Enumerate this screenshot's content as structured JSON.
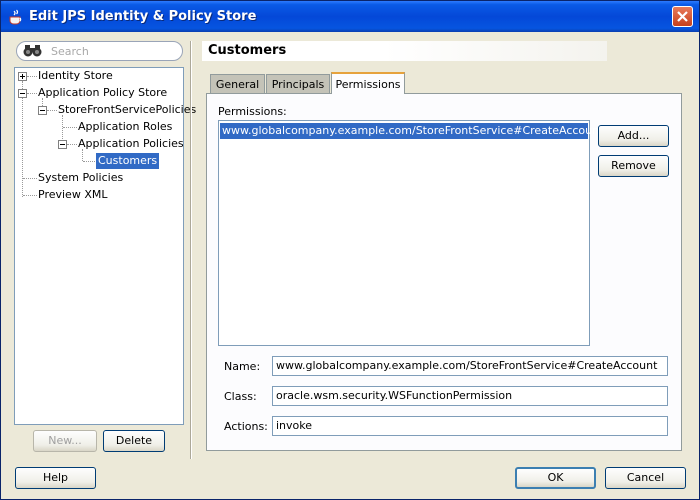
{
  "window": {
    "title": "Edit JPS Identity & Policy Store"
  },
  "search": {
    "placeholder": "Search"
  },
  "tree": [
    {
      "label": "Identity Store",
      "expander": "plus"
    },
    {
      "label": "Application Policy Store",
      "expander": "minus"
    },
    {
      "label": "StoreFrontServicePolicies",
      "expander": "minus"
    },
    {
      "label": "Application Roles"
    },
    {
      "label": "Application Policies",
      "expander": "minus"
    },
    {
      "label": "Customers",
      "selected": true
    },
    {
      "label": "System Policies"
    },
    {
      "label": "Preview XML"
    }
  ],
  "left_buttons": {
    "new": "New...",
    "delete": "Delete"
  },
  "section": {
    "title": "Customers"
  },
  "tabs": [
    {
      "label": "General"
    },
    {
      "label": "Principals"
    },
    {
      "label": "Permissions",
      "active": true
    }
  ],
  "permissions": {
    "label": "Permissions:",
    "items": [
      "www.globalcompany.example.com/StoreFrontService#CreateAccount"
    ],
    "add_label": "Add...",
    "remove_label": "Remove"
  },
  "fields": {
    "name_label": "Name:",
    "name_value": "www.globalcompany.example.com/StoreFrontService#CreateAccount",
    "class_label": "Class:",
    "class_value": "oracle.wsm.security.WSFunctionPermission",
    "actions_label": "Actions:",
    "actions_value": "invoke"
  },
  "footer": {
    "help": "Help",
    "ok": "OK",
    "cancel": "Cancel"
  },
  "colors": {
    "title_bar": "#0448d8",
    "selection": "#316ac5",
    "dialog_bg": "#ece9d8",
    "active_tab_accent": "#e6a23c"
  }
}
